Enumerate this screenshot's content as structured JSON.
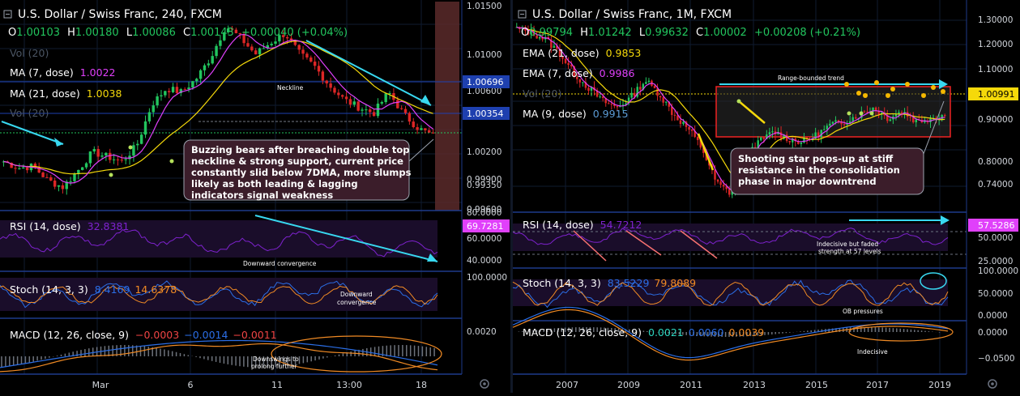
{
  "colors": {
    "bg": "#000000",
    "grid": "#0e1a2e",
    "sep": "#1e3a8a",
    "up": "#22c55e",
    "down": "#dc2626",
    "cyan": "#38d8f0",
    "pink": "#e040fb",
    "yellow": "#f5d90a",
    "orange": "#f08a24",
    "blue": "#2b6ee6",
    "annot_bg": "#3b1d2a",
    "red_box": "#ef2323",
    "pivot_dot": "#f5b800",
    "green_dot": "#b4e05a"
  },
  "left": {
    "title": "U.S. Dollar / Swiss Franc, 240, FXCM",
    "ohlc": {
      "o_label": "O",
      "o": "1.00103",
      "h_label": "H",
      "h": "1.00180",
      "l_label": "L",
      "l": "1.00086",
      "c_label": "C",
      "c": "1.00143",
      "change": "+0.00040 (+0.04%)"
    },
    "vol": "Vol (20)",
    "ma7": {
      "label": "MA (7, dose)",
      "value": "1.0022"
    },
    "ma21": {
      "label": "MA (21, dose)",
      "value": "1.0038"
    },
    "vol2": "Vol (20)",
    "neckline": "Neckline",
    "annotation": "Buzzing bears after breaching double top neckline & strong support, current price constantly slid below 7DMA, more slumps likely as both leading & lagging indicators signal weakness",
    "price_axis": [
      "1.01500",
      "1.01000",
      "1.00600",
      "1.00200",
      "0.99900",
      "0.99600",
      "0.99350"
    ],
    "price_tags": [
      {
        "text": "1.00696",
        "color": "#1e40af"
      },
      {
        "text": "1.00354",
        "color": "#1e40af"
      }
    ],
    "rsi": {
      "label": "RSI (14, dose)",
      "value": "32.8381",
      "tag": "69.7281",
      "axis": [
        "80.0000",
        "60.0000",
        "40.0000"
      ],
      "note": "Downward convergence"
    },
    "stoch": {
      "label": "Stoch (14, 3, 3)",
      "k": "8.4169",
      "d": "14.6378",
      "axis": [
        "100.0000"
      ],
      "note": "Downward convergence"
    },
    "macd": {
      "label": "MACD (12, 26, close, 9)",
      "v1": "−0.0003",
      "v2": "−0.0014",
      "v3": "−0.0011",
      "axis": [
        "0.0020"
      ],
      "note": "Downswings to prolong further"
    },
    "x_axis": [
      "Mar",
      "6",
      "11",
      "13:00",
      "18"
    ]
  },
  "right": {
    "title": "U.S. Dollar / Swiss Franc, 1M, FXCM",
    "ohlc": {
      "o_label": "O",
      "o": "0.99794",
      "h_label": "H",
      "h": "1.01242",
      "l_label": "L",
      "l": "0.99632",
      "c_label": "C",
      "c": "1.00002",
      "change": "+0.00208 (+0.21%)"
    },
    "ema21": {
      "label": "EMA (21, dose)",
      "value": "0.9853"
    },
    "ema7": {
      "label": "EMA (7, dose)",
      "value": "0.9986"
    },
    "vol": "Vol (20)",
    "ma9": {
      "label": "MA (9, dose)",
      "value": "0.9915"
    },
    "range_label": "Range-bounded trend",
    "annotation": "Shooting star pops-up at stiff resistance in the consolidation phase in major downtrend",
    "price_axis": [
      "1.30000",
      "1.20000",
      "1.10000",
      "1.00000",
      "0.90000",
      "0.80000",
      "0.74000"
    ],
    "price_tag": {
      "text": "1.00991",
      "color": "#f5d90a"
    },
    "rsi": {
      "label": "RSI (14, dose)",
      "value": "54.7212",
      "tag": "57.5286",
      "axis": [
        "50.0000",
        "25.0000"
      ],
      "note": "Indecisive but faded strength at 57 levels"
    },
    "stoch": {
      "label": "Stoch (14, 3, 3)",
      "k": "83.5229",
      "d": "79.8089",
      "axis": [
        "100.0000",
        "50.0000",
        "0.0000"
      ],
      "note": "OB pressures"
    },
    "macd": {
      "label": "MACD (12, 26, close, 9)",
      "v1": "0.0021",
      "v2": "0.0060",
      "v3": "0.0039",
      "axis": [
        "0.0000",
        "−0.0500"
      ],
      "note": "Indecisive"
    },
    "x_axis": [
      "2007",
      "2009",
      "2011",
      "2013",
      "2015",
      "2017",
      "2019"
    ]
  },
  "chart_data": [
    {
      "type": "candlestick",
      "title": "U.S. Dollar / Swiss Franc, 240, FXCM",
      "indicators": [
        "Vol (20)",
        "MA (7, dose)",
        "MA (21, dose)",
        "RSI (14, dose)",
        "Stoch (14, 3, 3)",
        "MACD (12, 26, close, 9)"
      ],
      "x_ticks": [
        "Mar",
        "6",
        "11",
        "13:00",
        "18"
      ],
      "ylim": [
        0.9935,
        1.015
      ],
      "close_path": [
        0.9985,
        0.9978,
        0.998,
        0.9965,
        0.9958,
        0.9975,
        0.9995,
        0.999,
        0.9985,
        1.0002,
        1.0045,
        1.0062,
        1.0058,
        1.0072,
        1.0095,
        1.0128,
        1.0115,
        1.0098,
        1.011,
        1.012,
        1.0098,
        1.0085,
        1.0065,
        1.005,
        1.0042,
        1.0036,
        1.0058,
        1.0035,
        1.002,
        1.0012
      ]
    },
    {
      "type": "candlestick",
      "title": "U.S. Dollar / Swiss Franc, 1M, FXCM",
      "indicators": [
        "EMA (21, dose)",
        "EMA (7, dose)",
        "Vol (20)",
        "MA (9, dose)",
        "RSI (14, dose)",
        "Stoch (14, 3, 3)",
        "MACD (12, 26, close, 9)"
      ],
      "x_ticks": [
        "2007",
        "2009",
        "2011",
        "2013",
        "2015",
        "2017",
        "2019"
      ],
      "ylim": [
        0.72,
        1.32
      ],
      "close_path": [
        1.25,
        1.24,
        1.22,
        1.18,
        1.12,
        1.08,
        1.04,
        1.02,
        1.05,
        1.1,
        1.06,
        1.0,
        0.96,
        0.9,
        0.8,
        0.77,
        0.88,
        0.92,
        0.95,
        0.93,
        0.92,
        0.94,
        0.97,
        0.98,
        1.0,
        1.02,
        0.99,
        1.01,
        0.98,
        0.99,
        1.0
      ]
    }
  ]
}
